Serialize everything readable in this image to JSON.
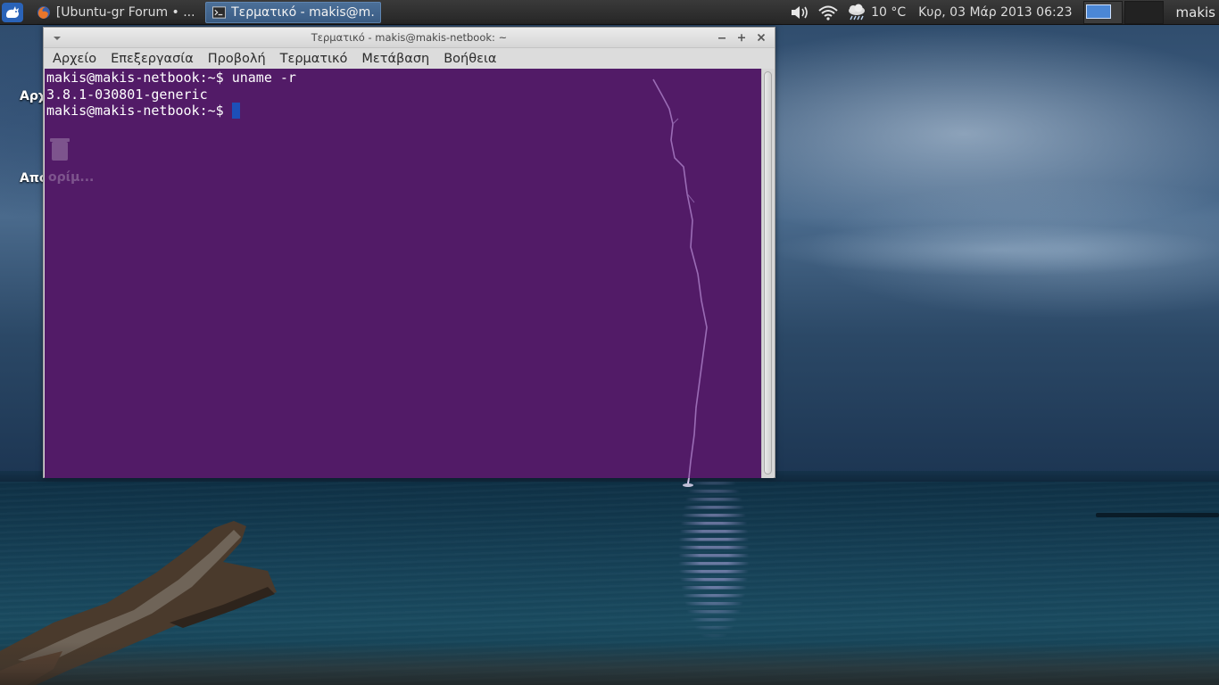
{
  "panel": {
    "menu_icon": "xfce-mouse-icon",
    "tasks": [
      {
        "label": "[Ubuntu-gr Forum • ...",
        "icon": "firefox-icon",
        "active": false
      },
      {
        "label": "Τερματικό - makis@m...",
        "icon": "terminal-icon",
        "active": true
      }
    ],
    "tray": {
      "icons": [
        "volume-icon",
        "wifi-icon",
        "weather-icon"
      ],
      "temperature": "10 °C",
      "clock": "Κυρ, 03 Μάρ 2013 06:23",
      "workspaces": 2,
      "current_workspace": 1,
      "user": "makis"
    },
    "colors": {
      "panel_bg": "#262626",
      "active_task": "#3a5c84"
    }
  },
  "desktop": {
    "icon_labels": [
      "Αρχ",
      "Απο"
    ]
  },
  "terminal_window": {
    "title": "Τερματικό - makis@makis-netbook: ~",
    "menu": [
      "Αρχείο",
      "Επεξεργασία",
      "Προβολή",
      "Τερματικό",
      "Μετάβαση",
      "Βοήθεια"
    ],
    "lines": [
      "makis@makis-netbook:~$ uname -r",
      "3.8.1-030801-generic",
      "makis@makis-netbook:~$ "
    ],
    "ghost_label": "ορίμ...",
    "colors": {
      "background": "#521b67",
      "foreground": "#ffffff",
      "cursor": "#1c4fb8"
    }
  }
}
